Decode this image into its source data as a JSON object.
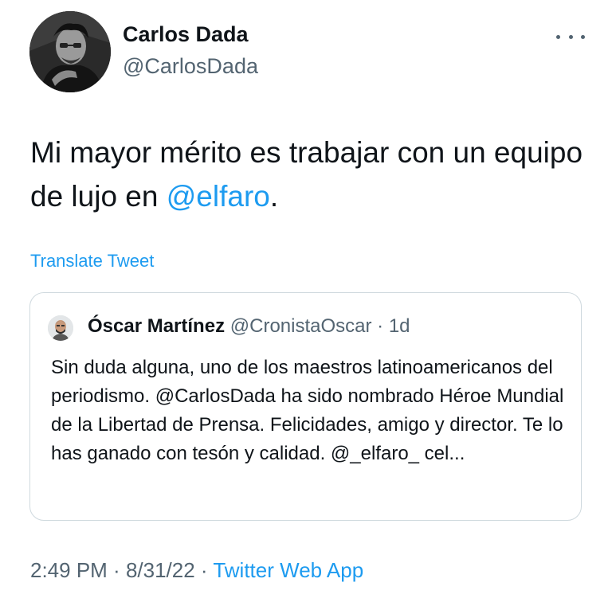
{
  "author": {
    "name": "Carlos Dada",
    "handle": "@CarlosDada",
    "avatar_icon": "profile-photo"
  },
  "tweet": {
    "text_before": "Mi mayor mérito es trabajar con un equipo de lujo en ",
    "mention": "@elfaro",
    "text_after": ".",
    "translate_label": "Translate Tweet",
    "more_icon": "ellipsis-icon"
  },
  "quoted": {
    "name": "Óscar Martínez",
    "handle": "@CronistaOscar",
    "separator": " · ",
    "age": "1d",
    "text": "Sin duda alguna, uno de los maestros latinoamericanos del periodismo. @CarlosDada ha sido nombrado Héroe Mundial de la Libertad de Prensa. Felicidades, amigo y director.  Te lo has ganado con tesón y calidad. @_elfaro_ cel..."
  },
  "meta": {
    "time": "2:49 PM",
    "sep1": " · ",
    "date": "8/31/22",
    "sep2": " · ",
    "app": "Twitter Web App"
  },
  "colors": {
    "link": "#1d9bf0",
    "secondary": "#536471",
    "border": "#cfd9de"
  }
}
